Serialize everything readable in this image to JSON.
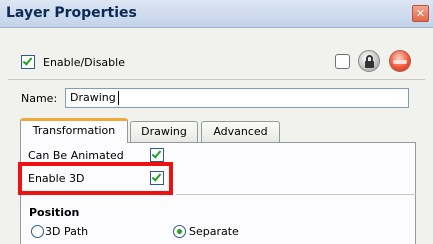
{
  "window": {
    "title": "Layer Properties",
    "close_glyph": "✕"
  },
  "header": {
    "enable_label": "Enable/Disable",
    "enable_checked": true,
    "icons": [
      "empty-box-icon",
      "lock-icon",
      "color-swatch-icon"
    ]
  },
  "name": {
    "label": "Name:",
    "value": "Drawing"
  },
  "tabs": [
    {
      "label": "Transformation",
      "active": true
    },
    {
      "label": "Drawing",
      "active": false
    },
    {
      "label": "Advanced",
      "active": false
    }
  ],
  "transformation": {
    "can_be_animated_label": "Can Be Animated",
    "can_be_animated_checked": true,
    "enable_3d_label": "Enable 3D",
    "enable_3d_checked": true
  },
  "position": {
    "title": "Position",
    "options": [
      {
        "label": "3D Path",
        "selected": false
      },
      {
        "label": "Separate",
        "selected": true
      }
    ]
  },
  "colors": {
    "highlight": "#ee1111",
    "active_tab_accent": "#f0a83a",
    "check_mark": "#21a121",
    "title_text": "#0b2a55"
  }
}
